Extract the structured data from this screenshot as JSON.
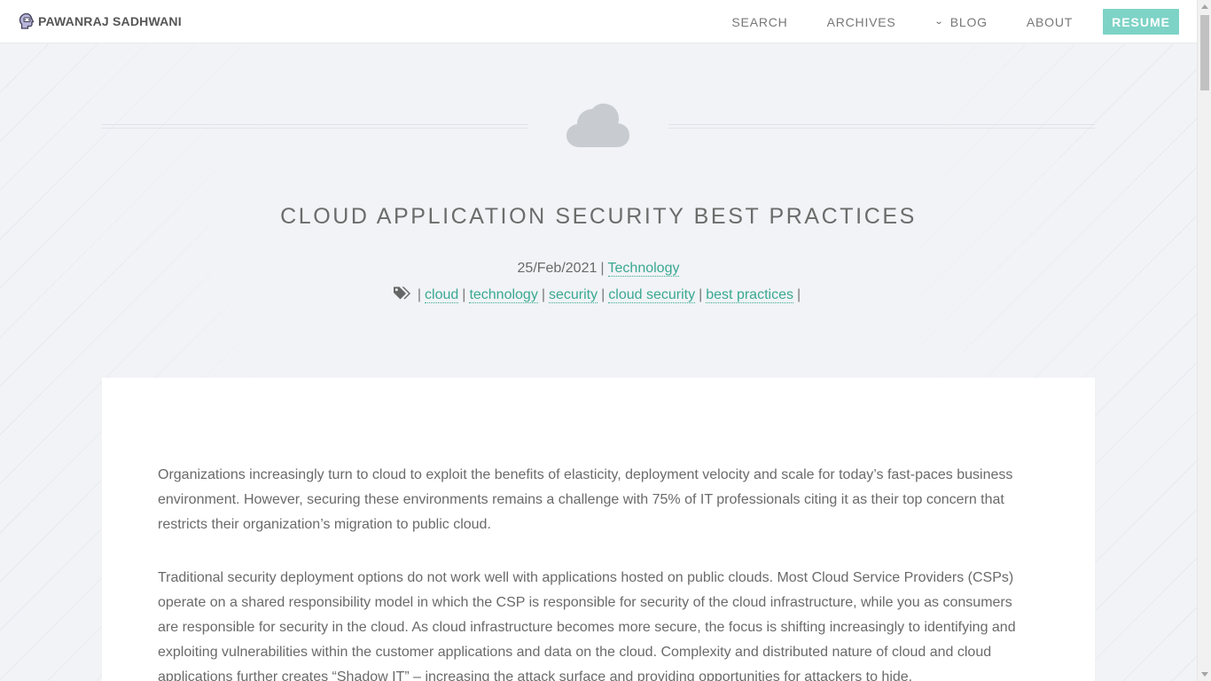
{
  "nav": {
    "brand": "PAWANRAJ SADHWANI",
    "items": [
      {
        "label": "SEARCH"
      },
      {
        "label": "ARCHIVES"
      },
      {
        "label": "BLOG",
        "icon": "chevron-down-icon"
      },
      {
        "label": "ABOUT"
      }
    ],
    "resume_label": "RESUME",
    "accent_color": "#7dd3c6"
  },
  "post": {
    "icon": "cloud-icon",
    "title": "CLOUD APPLICATION SECURITY BEST PRACTICES",
    "date": "25/Feb/2021",
    "category": "Technology",
    "tags_icon": "tags-icon",
    "tags": [
      "cloud",
      "technology",
      "security",
      "cloud security",
      "best practices"
    ],
    "paragraphs": [
      "Organizations increasingly turn to cloud to exploit the benefits of elasticity, deployment velocity and scale for today’s fast-paces business environment. However, securing these environments remains a challenge with 75% of IT professionals citing it as their top concern that restricts their organization’s migration to public cloud.",
      "Traditional security deployment options do not work well with applications hosted on public clouds. Most Cloud Service Providers (CSPs) operate on a shared responsibility model in which the CSP is responsible for security of the cloud infrastructure, while you as consumers are responsible for security in the cloud. As cloud infrastructure becomes more secure, the focus is shifting increasingly to identifying and exploiting vulnerabilities within the customer applications and data on the cloud. Complexity and distributed nature of cloud and cloud applications further creates “Shadow IT” – increasing the attack surface and providing opportunities for attackers to hide."
    ]
  }
}
